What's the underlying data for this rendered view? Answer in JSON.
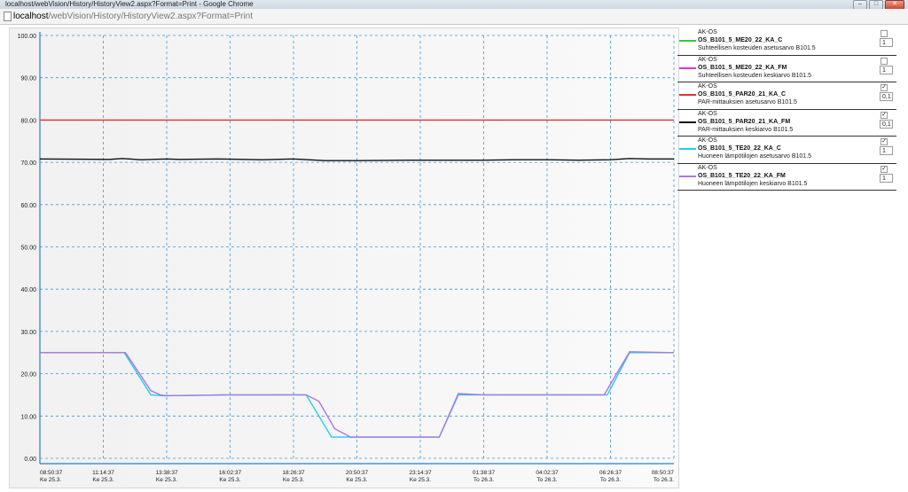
{
  "window": {
    "title": "localhost/webVision/History/HistoryView2.aspx?Format=Print - Google Chrome",
    "minimize": "–",
    "maximize": "□",
    "close": "✕"
  },
  "address": {
    "host": "localhost",
    "path": "/webVision/History/HistoryView2.aspx?Format=Print"
  },
  "chart_data": {
    "type": "line",
    "ylim": [
      0,
      100
    ],
    "yticks": [
      "100.00",
      "90.00",
      "80.00",
      "70.00",
      "60.00",
      "50.00",
      "40.00",
      "30.00",
      "20.00",
      "10.00",
      "0.00"
    ],
    "xticks": [
      {
        "time": "08:50:37",
        "day": "Ke 25.3."
      },
      {
        "time": "11:14:37",
        "day": "Ke 25.3."
      },
      {
        "time": "13:38:37",
        "day": "Ke 25.3."
      },
      {
        "time": "16:02:37",
        "day": "Ke 25.3."
      },
      {
        "time": "18:26:37",
        "day": "Ke 25.3."
      },
      {
        "time": "20:50:37",
        "day": "Ke 25.3."
      },
      {
        "time": "23:14:37",
        "day": "Ke 25.3."
      },
      {
        "time": "01:38:37",
        "day": "To 26.3."
      },
      {
        "time": "04:02:37",
        "day": "To 26.3."
      },
      {
        "time": "06:26:37",
        "day": "To 26.3."
      },
      {
        "time": "08:50:37",
        "day": "To 26.3."
      }
    ],
    "series": [
      {
        "name": "OS_B101_5_PAR20_21_KA_C",
        "color": "#e03030",
        "x": [
          0,
          10
        ],
        "y": [
          80,
          80
        ]
      },
      {
        "name": "OS_B101_5_PAR20_21_KA_FM",
        "color": "#111111",
        "x": [
          0,
          1.1,
          1.3,
          1.6,
          2.0,
          2.2,
          2.8,
          3.5,
          4.0,
          4.5,
          5.0,
          5.8,
          6.5,
          7.0,
          7.5,
          8.0,
          8.5,
          9.0,
          9.3,
          9.6,
          10
        ],
        "y": [
          70.8,
          70.7,
          70.9,
          70.6,
          70.8,
          70.7,
          70.8,
          70.6,
          70.8,
          70.4,
          70.4,
          70.5,
          70.5,
          70.5,
          70.6,
          70.6,
          70.5,
          70.6,
          70.9,
          70.8,
          70.8
        ]
      },
      {
        "name": "OS_B101_5_TE20_22_KA_C",
        "color": "#22ccee",
        "x": [
          0,
          1.33,
          1.75,
          1.95,
          3.0,
          4.2,
          4.6,
          5.0,
          6.0,
          6.3,
          6.6,
          7.0,
          8.0,
          8.95,
          9.3,
          10
        ],
        "y": [
          25,
          25,
          15,
          14.8,
          15,
          15,
          5,
          5,
          5,
          5,
          15,
          15,
          15,
          15,
          25,
          25
        ]
      },
      {
        "name": "OS_B101_5_TE20_22_KA_FM",
        "color": "#aa77dd",
        "x": [
          0,
          1.35,
          1.75,
          1.9,
          2.0,
          3.0,
          4.2,
          4.4,
          4.65,
          4.9,
          5.5,
          6.0,
          6.3,
          6.6,
          7.0,
          8.0,
          8.9,
          9.3,
          10
        ],
        "y": [
          25,
          25,
          16,
          15,
          14.8,
          15,
          15,
          13.5,
          7,
          5,
          5,
          5,
          5,
          15.3,
          15,
          15,
          15,
          25.2,
          25
        ]
      }
    ]
  },
  "legend": [
    {
      "group": "AK-OS",
      "name": "OS_B101_5_ME20_22_KA_C",
      "desc": "Suhteellisen kosteuden asetusarvo B101.5",
      "color": "#33cc33",
      "checked": "",
      "value": "1"
    },
    {
      "group": "AK-OS",
      "name": "OS_B101_5_ME20_22_KA_FM",
      "desc": "Suhteellisen kosteuden keskiarvo B101.5",
      "color": "#dd33cc",
      "checked": "",
      "value": "1"
    },
    {
      "group": "AK-OS",
      "name": "OS_B101_5_PAR20_21_KA_C",
      "desc": "PAR-mittauksien asetusarvo B101.5",
      "color": "#e03030",
      "checked": "✓",
      "value": "0,1"
    },
    {
      "group": "AK-OS",
      "name": "OS_B101_5_PAR20_21_KA_FM",
      "desc": "PAR-mittauksien keskiarvo B101.5",
      "color": "#111111",
      "checked": "✓",
      "value": "0,1"
    },
    {
      "group": "AK-OS",
      "name": "OS_B101_5_TE20_22_KA_C",
      "desc": "Huoneen lämpötilojen asetusarvo B101.5",
      "color": "#22ccee",
      "checked": "✓",
      "value": "1"
    },
    {
      "group": "AK-OS",
      "name": "OS_B101_5_TE20_22_KA_FM",
      "desc": "Huoneen lämpötilojen keskiarvo B101.5",
      "color": "#aa77dd",
      "checked": "✓",
      "value": "1"
    }
  ]
}
